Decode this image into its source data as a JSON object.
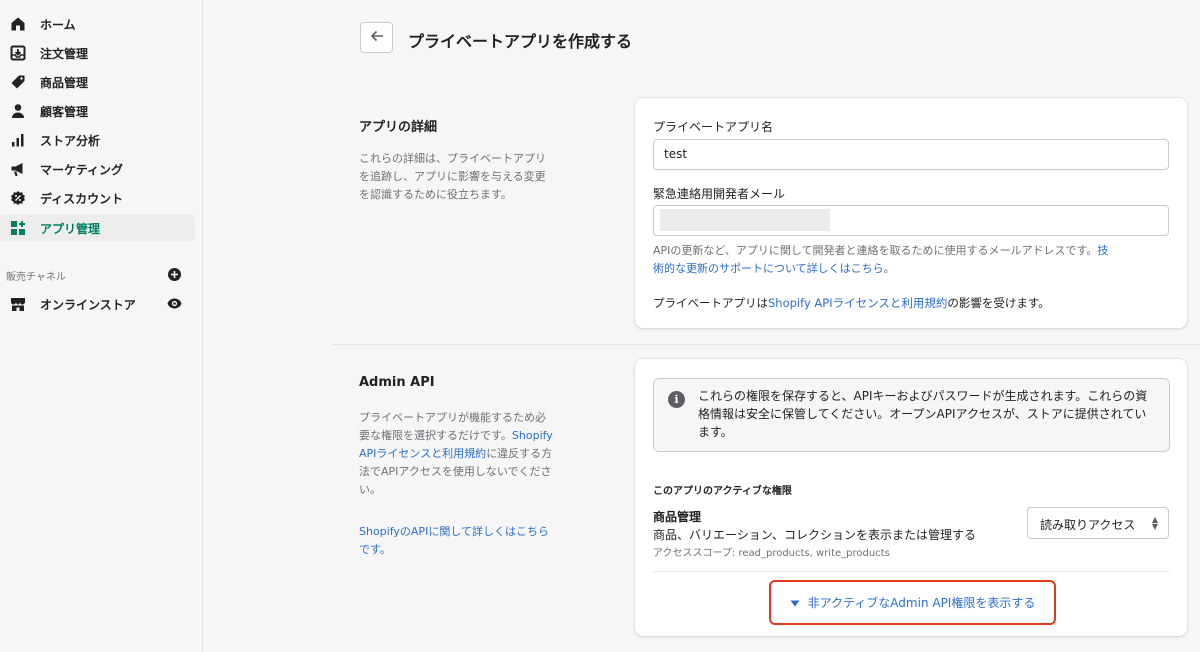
{
  "sidebar": {
    "items": [
      {
        "label": "ホーム",
        "icon": "home-icon"
      },
      {
        "label": "注文管理",
        "icon": "orders-icon"
      },
      {
        "label": "商品管理",
        "icon": "tag-icon"
      },
      {
        "label": "顧客管理",
        "icon": "customer-icon"
      },
      {
        "label": "ストア分析",
        "icon": "analytics-icon"
      },
      {
        "label": "マーケティング",
        "icon": "megaphone-icon"
      },
      {
        "label": "ディスカウント",
        "icon": "discount-icon"
      },
      {
        "label": "アプリ管理",
        "icon": "apps-icon",
        "active": true
      }
    ],
    "sales_channels_label": "販売チャネル",
    "online_store_label": "オンラインストア"
  },
  "page": {
    "title": "プライベートアプリを作成する"
  },
  "details": {
    "title": "アプリの詳細",
    "desc_lines": [
      "これらの詳細は、プライベートアプリ",
      "を追跡し、アプリに影響を与える変更",
      "を認識するために役立ちます。"
    ],
    "app_name_label": "プライベートアプリ名",
    "app_name_value": "test",
    "email_label": "緊急連絡用開発者メール",
    "email_help_1": "APIの更新など、アプリに関して開発者と連絡を取るために使用するメールアドレスです。",
    "email_help_link_a": "技",
    "email_help_link_b": "術的な更新のサポートについて詳しくはこちら",
    "email_help_end": "。",
    "terms_prefix": "プライベートアプリは",
    "terms_link": "Shopify APIライセンスと利用規約",
    "terms_suffix": "の影響を受けます。"
  },
  "admin_api": {
    "title": "Admin API",
    "desc_1": "プライベートアプリが機能するため必",
    "desc_2a": "要な権限を選択するだけです。",
    "desc_2b": "Shopify",
    "desc_3a": "APIライセンスと利用規約",
    "desc_3b": "に違反する方",
    "desc_4": "法でAPIアクセスを使用しないでくださ",
    "desc_5": "い。",
    "learn_more_1": "ShopifyのAPIに関して詳しくはこちら",
    "learn_more_2": "です。",
    "banner_text": "これらの権限を保存すると、APIキーおよびパスワードが生成されます。これらの資格情報は安全に保管してください。オープンAPIアクセスが、ストアに提供されています。",
    "active_perms_heading": "このアプリのアクティブな権限",
    "perm_name": "商品管理",
    "perm_desc": "商品、バリエーション、コレクションを表示または管理する",
    "perm_scope": "アクセススコープ: read_products, write_products",
    "perm_access": "読み取りアクセス",
    "show_inactive": "非アクティブなAdmin API権限を表示する"
  },
  "colors": {
    "accent": "#008060",
    "link": "#2c6ecb",
    "highlight": "#e03a1f"
  }
}
